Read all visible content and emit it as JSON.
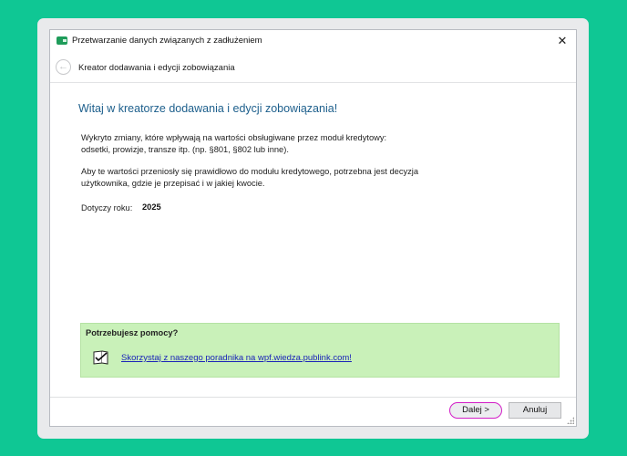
{
  "window": {
    "title": "Przetwarzanie danych związanych z zadłużeniem",
    "close_glyph": "✕"
  },
  "nav": {
    "back_glyph": "←",
    "title": "Kreator dodawania i edycji zobowiązania"
  },
  "main": {
    "heading": "Witaj w kreatorze dodawania i edycji zobowiązania!",
    "para1_line1": "Wykryto zmiany, które wpływają na wartości obsługiwane przez moduł kredytowy:",
    "para1_line2": "odsetki, prowizje, transze itp. (np. §801, §802 lub inne).",
    "para2_line1": "Aby te wartości przeniosły się prawidłowo do modułu kredytowego, potrzebna jest decyzja",
    "para2_line2": "użytkownika, gdzie je przepisać i w jakiej kwocie.",
    "year_label": "Dotyczy roku:",
    "year_value": "2025"
  },
  "help": {
    "title": "Potrzebujesz pomocy?",
    "link_text": "Skorzystaj z naszego poradnika na wpf.wiedza.publink.com!",
    "icon": "guide-check-icon"
  },
  "buttons": {
    "next": "Dalej >",
    "cancel": "Anuluj"
  },
  "colors": {
    "background": "#0fc794",
    "heading": "#1d5f8c",
    "help_box": "#c9f1b9",
    "link": "#1a23b8",
    "next_highlight": "#d21fc7"
  }
}
